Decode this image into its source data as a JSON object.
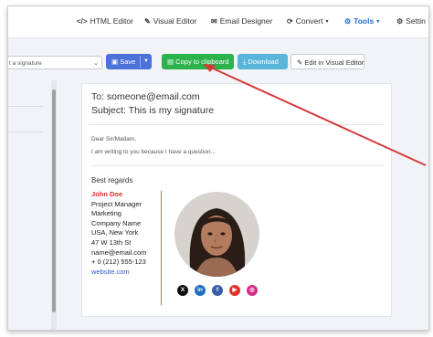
{
  "nav": {
    "html_editor": "HTML Editor",
    "visual_editor": "Visual Editor",
    "email_designer": "Email Designer",
    "convert": "Convert",
    "tools": "Tools",
    "settings": "Settin"
  },
  "toolbar": {
    "select_value": "t a signature",
    "save": "Save",
    "copy": "Copy to clipboard",
    "download": "Download",
    "edit_visual": "Edit in Visual Editor"
  },
  "email": {
    "to": "To: someone@email.com",
    "subject": "Subject: This is my signature",
    "greeting": "Dear Sir/Madam,",
    "body": "I am writing to you because I have a question...",
    "regards": "Best regards"
  },
  "signature": {
    "name": "John Doe",
    "title": "Project Manager",
    "department": "Marketing",
    "company": "Company Name",
    "location": "USA, New York",
    "street": "47 W 13th St",
    "email": "name@email.com",
    "phone": "+ 0 (212) 555-123",
    "website": "website.com"
  },
  "socials": [
    "x-icon",
    "linkedin-icon",
    "facebook-icon",
    "youtube-icon",
    "instagram-icon"
  ],
  "colors": {
    "accent_blue": "#1f6fd1",
    "save_blue": "#4a72d8",
    "copy_green": "#2ab34c",
    "download_cyan": "#59b6da",
    "annotation_red": "#d63a3a",
    "name_red": "#e8262a"
  }
}
